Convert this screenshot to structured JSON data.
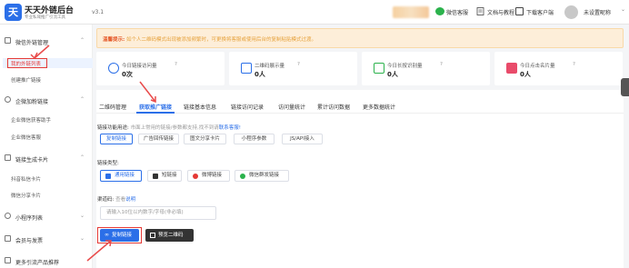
{
  "app": {
    "logo_char": "天",
    "title": "天天外链后台",
    "subtitle": "专业私域推广引流工具",
    "version": "v3.1"
  },
  "topbar": {
    "wechat_service": "微信客服",
    "docs": "文档与教程",
    "download": "下载客户端",
    "user": "未设置昵称",
    "user_arrow": "⌄"
  },
  "sidebar": {
    "group1": "微信外链管理",
    "group1_item1": "我的外链列表",
    "group1_item2": "创建推广链接",
    "group2": "企微加粉链接",
    "group2_item1": "企业微信获客助手",
    "group2_item2": "企业微信客服",
    "group3": "链接生成卡片",
    "group3_item1": "抖音私信卡片",
    "group3_item2": "微信分享卡片",
    "group4": "小程序列表",
    "group5": "会员与发票",
    "group6": "更多引流产品推荐",
    "arrow_up": "⌃",
    "arrow_down": "⌄"
  },
  "notice": {
    "title": "温馨提示:",
    "text": "如个人二维码模式出现被添加频繁时，可更换将客服或使用后台的复制粘贴模式过渡。"
  },
  "stats": [
    {
      "label": "今日链接访问量",
      "value": "0次",
      "icon_color": "#2b6fe8"
    },
    {
      "label": "二维码展示量",
      "value": "0人",
      "icon_color": "#2b6fe8"
    },
    {
      "label": "今日长按识别量",
      "value": "0人",
      "icon_color": "#2bb24c"
    },
    {
      "label": "今日点击名片量",
      "value": "0人",
      "icon_color": "#e94b6a"
    }
  ],
  "help_mark": "?",
  "tabs": [
    "二维码管理",
    "获取推广链接",
    "链接基本信息",
    "链接访问记录",
    "访问量统计",
    "累计访问数据",
    "更多数据统计"
  ],
  "link_use": {
    "label": "链接功能用途:",
    "hint": "市面上常用的链接/参数都支持,找不到请",
    "contact": "联系客服!",
    "buttons": [
      "复制链接",
      "广告回传链接",
      "图文分享卡片",
      "小程序参数",
      "JS/API接入"
    ]
  },
  "link_type": {
    "label": "链接类型:",
    "buttons": [
      "通用链接",
      "短链接",
      "微博链接",
      "微信群发链接"
    ]
  },
  "channel": {
    "label": "渠道码:",
    "hint": "查看",
    "link": "说明",
    "placeholder": "请输入10位以内数字/字母(非必填)"
  },
  "actions": {
    "copy": "复制链接",
    "qr": "预览二维码"
  },
  "colors": {
    "primary": "#2b6fe8",
    "warning": "#e6a23c",
    "annotation": "#e53935"
  }
}
